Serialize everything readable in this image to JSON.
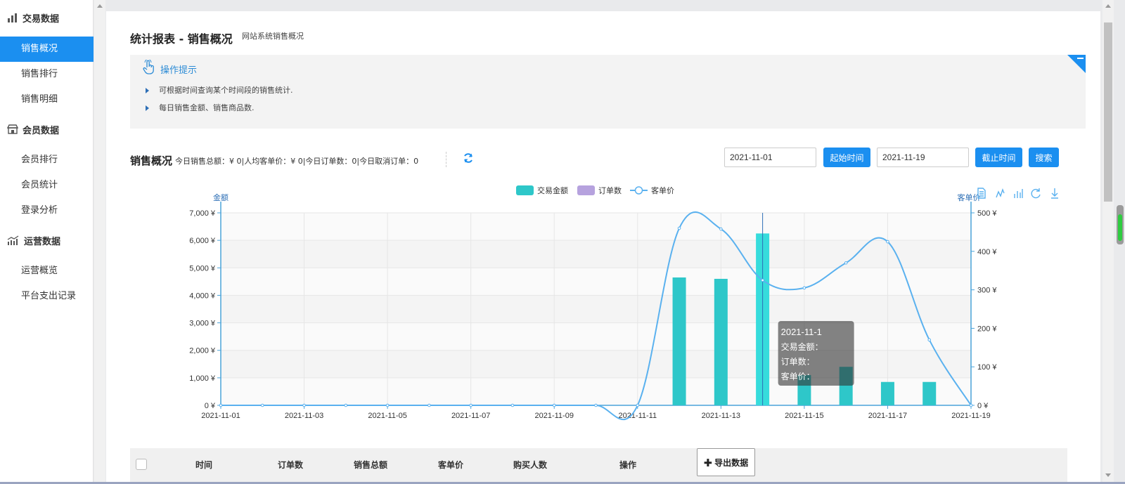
{
  "sidebar": {
    "groups": [
      {
        "title": "交易数据",
        "items": [
          "销售概况",
          "销售排行",
          "销售明细"
        ]
      },
      {
        "title": "会员数据",
        "items": [
          "会员排行",
          "会员统计",
          "登录分析"
        ]
      },
      {
        "title": "运营数据",
        "items": [
          "运营概览",
          "平台支出记录"
        ]
      }
    ],
    "active": "销售概况"
  },
  "page": {
    "title": "统计报表 - 销售概况",
    "subtitle": "网站系统销售概况"
  },
  "tips": {
    "title": "操作提示",
    "lines": [
      "可根据时间查询某个时间段的销售统计.",
      "每日销售金额、销售商品数."
    ]
  },
  "stats": {
    "title": "销售概况",
    "summary": "今日销售总额：¥ 0|人均客单价：¥ 0|今日订单数：0|今日取消订单：0"
  },
  "filters": {
    "start_date": "2021-11-01",
    "start_label": "起始时间",
    "end_date": "2021-11-19",
    "end_label": "截止时间",
    "search_label": "搜索"
  },
  "chart_data": {
    "type": "bar",
    "legend": [
      "交易金额",
      "订单数",
      "客单价"
    ],
    "legend_position": "top-center",
    "y_left_label": "金额",
    "y_right_label": "客单价",
    "y_left_ticks": [
      "7,000 ¥",
      "6,000 ¥",
      "5,000 ¥",
      "4,000 ¥",
      "3,000 ¥",
      "2,000 ¥",
      "1,000 ¥",
      "0 ¥"
    ],
    "y_right_ticks": [
      "500 ¥",
      "400 ¥",
      "300 ¥",
      "200 ¥",
      "100 ¥",
      "0 ¥"
    ],
    "ylim_left": [
      0,
      7000
    ],
    "ylim_right": [
      0,
      500
    ],
    "x_tick_labels": [
      "2021-11-01",
      "2021-11-03",
      "2021-11-05",
      "2021-11-07",
      "2021-11-09",
      "2021-11-11",
      "2021-11-13",
      "2021-11-15",
      "2021-11-17",
      "2021-11-19"
    ],
    "categories": [
      "2021-11-01",
      "2021-11-02",
      "2021-11-03",
      "2021-11-04",
      "2021-11-05",
      "2021-11-06",
      "2021-11-07",
      "2021-11-08",
      "2021-11-09",
      "2021-11-10",
      "2021-11-11",
      "2021-11-12",
      "2021-11-13",
      "2021-11-14",
      "2021-11-15",
      "2021-11-16",
      "2021-11-17",
      "2021-11-18",
      "2021-11-19"
    ],
    "series": [
      {
        "name": "交易金额",
        "type": "bar",
        "axis": "left",
        "color": "#2ec7c9",
        "values": [
          0,
          0,
          0,
          0,
          0,
          0,
          0,
          0,
          0,
          0,
          0,
          4650,
          4600,
          6250,
          1100,
          1400,
          850,
          850,
          0
        ]
      },
      {
        "name": "订单数",
        "type": "bar",
        "axis": "left",
        "color": "#b6a2de",
        "values": [
          0,
          0,
          0,
          0,
          0,
          0,
          0,
          0,
          0,
          0,
          0,
          0,
          0,
          0,
          0,
          0,
          0,
          0,
          0
        ]
      },
      {
        "name": "客单价",
        "type": "line",
        "axis": "right",
        "color": "#5ab1ef",
        "values": [
          0,
          0,
          0,
          0,
          0,
          0,
          0,
          0,
          0,
          0,
          0,
          460,
          458,
          325,
          305,
          370,
          425,
          170,
          0
        ]
      }
    ],
    "highlight_index": 13,
    "grid": true,
    "tooltip": {
      "date": "2021-11-1",
      "rows": [
        "交易金额：",
        "订单数：",
        "客单价："
      ]
    }
  },
  "table": {
    "headers": [
      "时间",
      "订单数",
      "销售总额",
      "客单价",
      "购买人数",
      "操作"
    ],
    "export_label": "导出数据"
  },
  "colors": {
    "accent": "#1b8ff0",
    "bar": "#2ec7c9",
    "line": "#5ab1ef"
  }
}
